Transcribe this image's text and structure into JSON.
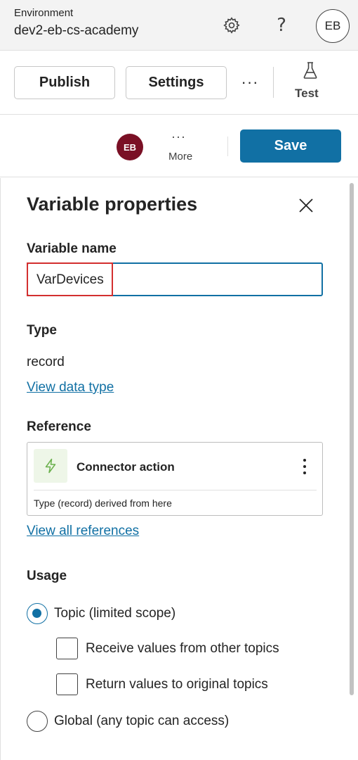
{
  "environment": {
    "label": "Environment",
    "name": "dev2-eb-cs-academy",
    "user_initials": "EB"
  },
  "toolbar": {
    "publish_label": "Publish",
    "settings_label": "Settings",
    "more_label": "···",
    "test_label": "Test"
  },
  "actions": {
    "avatar_initials": "EB",
    "more_dots": "···",
    "more_label": "More",
    "save_label": "Save"
  },
  "panel": {
    "title": "Variable properties",
    "variable_name_label": "Variable name",
    "variable_name_value": "VarDevices",
    "type_label": "Type",
    "type_value": "record",
    "view_data_type_link": "View data type",
    "reference_label": "Reference",
    "reference": {
      "title": "Connector action",
      "note": "Type (record) derived from here",
      "icon": "lightning-icon"
    },
    "view_all_references_link": "View all references",
    "usage_label": "Usage",
    "usage_options": [
      {
        "label": "Topic (limited scope)",
        "checked": true
      },
      {
        "label": "Global (any topic can access)",
        "checked": false
      }
    ],
    "topic_checkboxes": [
      {
        "label": "Receive values from other topics",
        "checked": false
      },
      {
        "label": "Return values to original topics",
        "checked": false
      }
    ]
  },
  "colors": {
    "accent": "#1170a4",
    "avatar": "#7a1025",
    "highlight": "#d32f2f"
  }
}
